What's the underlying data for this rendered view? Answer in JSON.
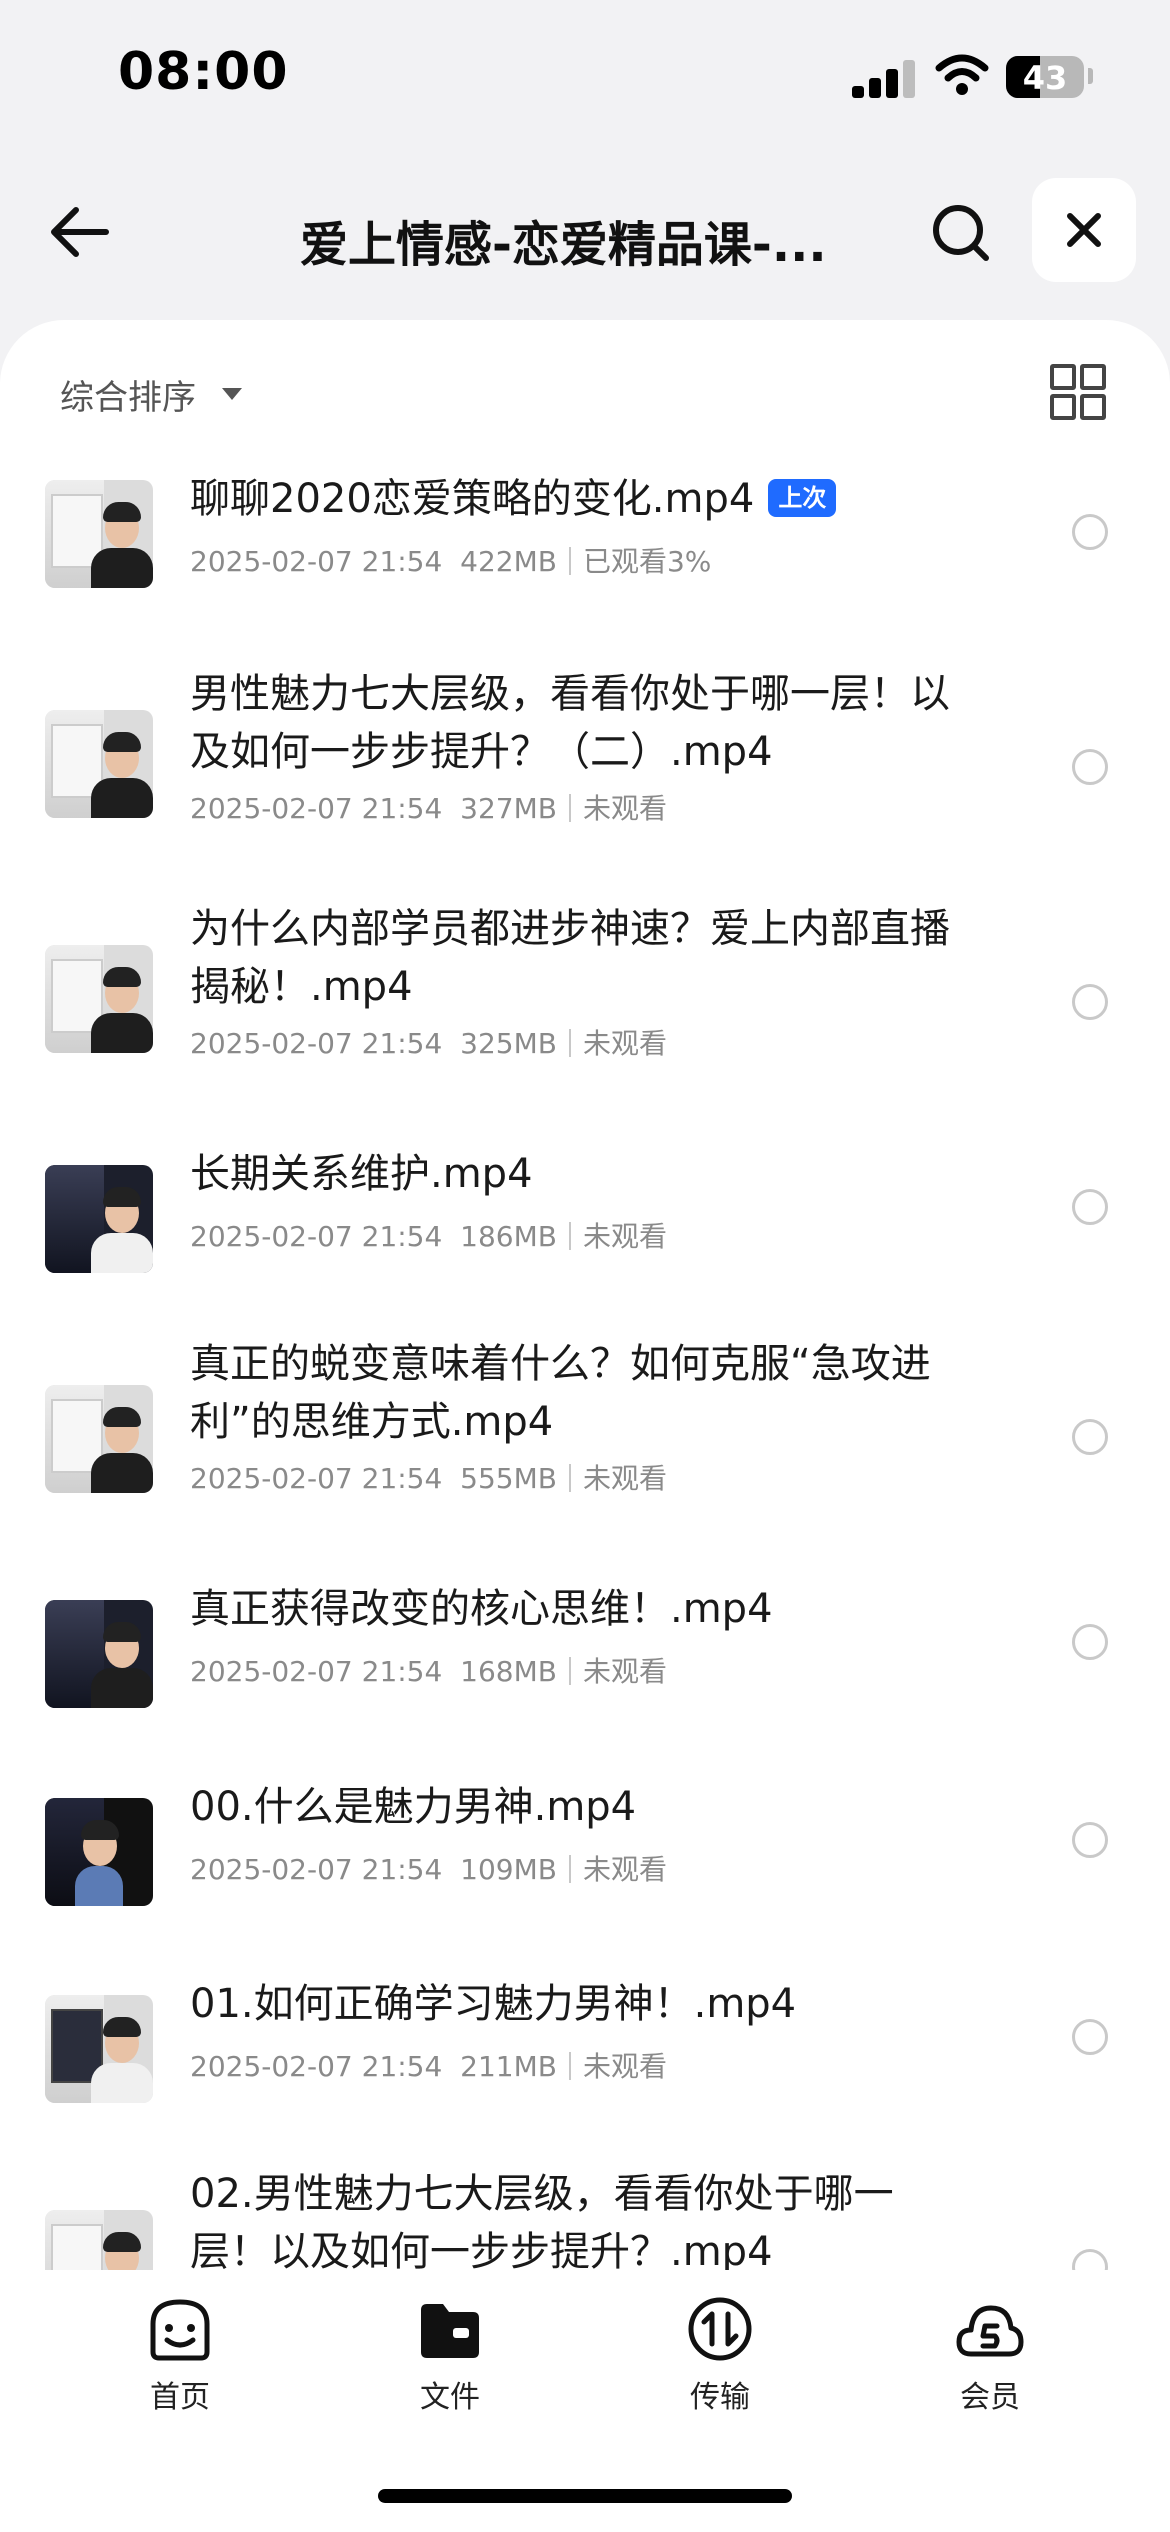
{
  "status_bar": {
    "time": "08:00",
    "battery": "43",
    "battery_level": 0.43
  },
  "header": {
    "title": "爱上情感-恋爱精品课-...",
    "back_icon": "back-arrow-icon",
    "search_icon": "search-icon",
    "close_icon": "close-icon"
  },
  "toolbar": {
    "sort_label": "综合排序",
    "view_icon": "grid-view-icon"
  },
  "files": [
    {
      "title": "聊聊2020恋爱策略的变化.mp4",
      "tag": "上次",
      "date": "2025-02-07 21:54",
      "size": "422MB",
      "status": "已观看3%"
    },
    {
      "title": "男性魅力七大层级，看看你处于哪一层！以及如何一步步提升？（二）.mp4",
      "date": "2025-02-07 21:54",
      "size": "327MB",
      "status": "未观看"
    },
    {
      "title": "为什么内部学员都进步神速？爱上内部直播揭秘！.mp4",
      "date": "2025-02-07 21:54",
      "size": "325MB",
      "status": "未观看"
    },
    {
      "title": "长期关系维护.mp4",
      "date": "2025-02-07 21:54",
      "size": "186MB",
      "status": "未观看"
    },
    {
      "title": "真正的蜕变意味着什么？如何克服“急攻进利”的思维方式.mp4",
      "date": "2025-02-07 21:54",
      "size": "555MB",
      "status": "未观看"
    },
    {
      "title": "真正获得改变的核心思维！.mp4",
      "date": "2025-02-07 21:54",
      "size": "168MB",
      "status": "未观看"
    },
    {
      "title": "00.什么是魅力男神.mp4",
      "date": "2025-02-07 21:54",
      "size": "109MB",
      "status": "未观看"
    },
    {
      "title": "01.如何正确学习魅力男神！.mp4",
      "date": "2025-02-07 21:54",
      "size": "211MB",
      "status": "未观看"
    },
    {
      "title": "02.男性魅力七大层级，看看你处于哪一层！以及如何一步步提升？.mp4"
    }
  ],
  "tab_bar": [
    {
      "label": "首页",
      "icon": "smiley-home-icon"
    },
    {
      "label": "文件",
      "icon": "folder-icon"
    },
    {
      "label": "传输",
      "icon": "transfer-icon"
    },
    {
      "label": "会员",
      "icon": "vip-cloud-icon"
    }
  ],
  "colors": {
    "accent": "#1f6bff",
    "background": "#f2f2f4",
    "card": "#ffffff",
    "meta_text": "#8a8a8a"
  }
}
